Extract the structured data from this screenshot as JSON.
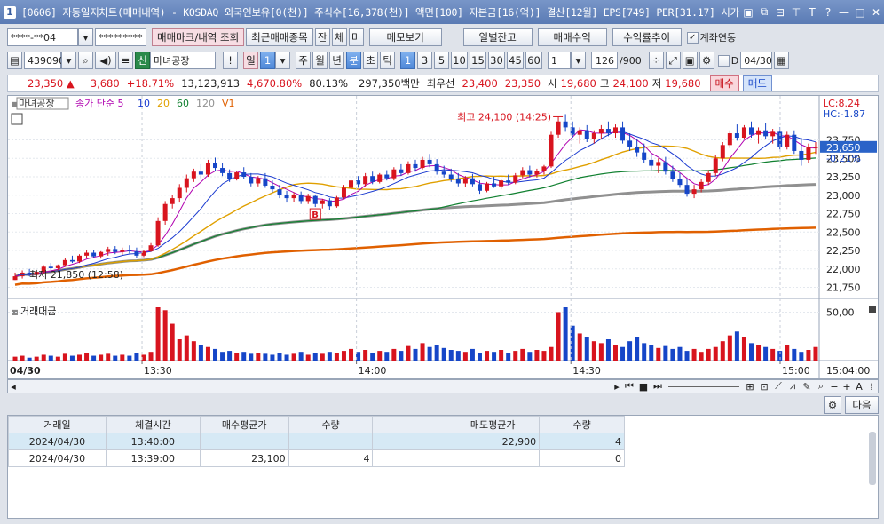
{
  "window": {
    "title": "[0606] 자동일지차트(매매내역) - KOSDAQ 외국인보유[0(천)] 주식수[16,378(천)] 액면[100] 자본금[16(억)] 결산[12월] EPS[749] PER[31.17] 시가"
  },
  "toolbar1": {
    "account": "****-**04",
    "password": "*********",
    "btn_trade_mark": "매매마크/내역 조회",
    "btn_recent": "최근매매종목",
    "btn_jan": "잔",
    "btn_che": "체",
    "btn_mi": "미",
    "btn_memo": "메모보기",
    "btn_daily": "일별잔고",
    "btn_profit": "매매수익",
    "btn_rate": "수익률추이",
    "check_account": "계좌연동"
  },
  "toolbar2": {
    "code": "439090",
    "sin": "신",
    "name": "마녀공장",
    "excl": "!",
    "il": "일",
    "il_num": "1",
    "periods": [
      "주",
      "월",
      "년"
    ],
    "bun": "분",
    "cho": "초",
    "tik": "틱",
    "intervals": [
      "1",
      "3",
      "5",
      "10",
      "15",
      "30",
      "45",
      "60"
    ],
    "count": "1",
    "bars": "126",
    "bars_total": "/900",
    "check_d": "D",
    "date": "04/30"
  },
  "pricebar": {
    "price": "23,350 ▲",
    "change": "3,680",
    "pct": "+18.71%",
    "volume": "13,123,913",
    "vol_pct": "4,670.80%",
    "ratio": "80.13%",
    "amount": "297,350백만",
    "best_label": "최우선",
    "best_ask": "23,400",
    "best_bid": "23,350",
    "open_label": "시",
    "open": "19,680",
    "high_label": "고",
    "high": "24,100",
    "low_label": "저",
    "low": "19,680",
    "buy": "매수",
    "sell": "매도"
  },
  "chart_data": [
    {
      "type": "candlestick",
      "legend": [
        {
          "name": "마녀공장",
          "color": "#333333"
        },
        {
          "name": "종가 단순 5",
          "color": "#b000b0"
        },
        {
          "name": "10",
          "color": "#1a3ad0"
        },
        {
          "name": "20",
          "color": "#e0a000"
        },
        {
          "name": "60",
          "color": "#108030"
        },
        {
          "name": "120",
          "color": "#909090"
        },
        {
          "name": "V1",
          "color": "#e06000"
        }
      ],
      "lc_label": "LC:8.24",
      "hc_label": "HC:-1.87",
      "current": "23,650",
      "current_value": 23650,
      "current_pct": "-0.21%",
      "high_annotation": "최고 24,100 (14:25)",
      "low_annotation": "최저 21,850 (12:58)",
      "trade_marker": "B",
      "y_ticks": [
        "23,750",
        "23,500",
        "23,250",
        "23,000",
        "22,750",
        "22,500",
        "22,250",
        "22,000",
        "21,750"
      ],
      "y_values": [
        23750,
        23500,
        23250,
        23000,
        22750,
        22500,
        22250,
        22000,
        21750
      ],
      "ylim": [
        21600,
        24250
      ],
      "date_label": "04/30",
      "x_ticks": [
        "13:30",
        "14:00",
        "14:30",
        "15:00",
        "15:04:00"
      ],
      "ohlc": [
        [
          21850,
          21950,
          21850,
          21900
        ],
        [
          21900,
          21980,
          21870,
          21950
        ],
        [
          21950,
          22000,
          21900,
          21920
        ],
        [
          21920,
          21980,
          21880,
          21960
        ],
        [
          21960,
          22050,
          21940,
          22030
        ],
        [
          22030,
          22080,
          21990,
          22010
        ],
        [
          22010,
          22060,
          21980,
          22050
        ],
        [
          22050,
          22150,
          22030,
          22120
        ],
        [
          22120,
          22180,
          22080,
          22100
        ],
        [
          22100,
          22200,
          22080,
          22180
        ],
        [
          22180,
          22250,
          22140,
          22220
        ],
        [
          22220,
          22260,
          22150,
          22170
        ],
        [
          22170,
          22240,
          22140,
          22230
        ],
        [
          22230,
          22300,
          22180,
          22270
        ],
        [
          22270,
          22310,
          22200,
          22230
        ],
        [
          22230,
          22290,
          22190,
          22260
        ],
        [
          22260,
          22320,
          22210,
          22240
        ],
        [
          22240,
          22290,
          22150,
          22180
        ],
        [
          22180,
          22260,
          22160,
          22240
        ],
        [
          22240,
          22350,
          22230,
          22320
        ],
        [
          22320,
          22700,
          22300,
          22650
        ],
        [
          22650,
          22920,
          22600,
          22880
        ],
        [
          22880,
          23000,
          22820,
          22960
        ],
        [
          22960,
          23150,
          22900,
          23100
        ],
        [
          23100,
          23280,
          23040,
          23230
        ],
        [
          23230,
          23360,
          23180,
          23320
        ],
        [
          23320,
          23420,
          23220,
          23280
        ],
        [
          23280,
          23480,
          23250,
          23440
        ],
        [
          23440,
          23510,
          23330,
          23370
        ],
        [
          23370,
          23440,
          23260,
          23300
        ],
        [
          23300,
          23350,
          23180,
          23220
        ],
        [
          23220,
          23330,
          23200,
          23310
        ],
        [
          23310,
          23380,
          23220,
          23250
        ],
        [
          23250,
          23300,
          23120,
          23160
        ],
        [
          23160,
          23260,
          23120,
          23230
        ],
        [
          23230,
          23300,
          23100,
          23130
        ],
        [
          23130,
          23200,
          23040,
          23080
        ],
        [
          23080,
          23140,
          22960,
          23000
        ],
        [
          23000,
          23060,
          22900,
          22960
        ],
        [
          22960,
          23040,
          22910,
          23010
        ],
        [
          23010,
          23050,
          22880,
          22920
        ],
        [
          22920,
          23020,
          22880,
          22990
        ],
        [
          22990,
          23010,
          22840,
          22880
        ],
        [
          22880,
          22950,
          22820,
          22930
        ],
        [
          22930,
          22960,
          22800,
          22850
        ],
        [
          22850,
          22990,
          22830,
          22970
        ],
        [
          22970,
          23140,
          22950,
          23100
        ],
        [
          23100,
          23240,
          23060,
          23200
        ],
        [
          23200,
          23260,
          23100,
          23150
        ],
        [
          23150,
          23300,
          23120,
          23260
        ],
        [
          23260,
          23320,
          23150,
          23180
        ],
        [
          23180,
          23300,
          23160,
          23280
        ],
        [
          23280,
          23340,
          23200,
          23230
        ],
        [
          23230,
          23380,
          23200,
          23350
        ],
        [
          23350,
          23420,
          23260,
          23300
        ],
        [
          23300,
          23460,
          23280,
          23420
        ],
        [
          23420,
          23480,
          23320,
          23370
        ],
        [
          23370,
          23520,
          23350,
          23480
        ],
        [
          23480,
          23560,
          23380,
          23420
        ],
        [
          23420,
          23490,
          23280,
          23320
        ],
        [
          23320,
          23400,
          23240,
          23280
        ],
        [
          23280,
          23360,
          23180,
          23220
        ],
        [
          23220,
          23300,
          23120,
          23160
        ],
        [
          23160,
          23260,
          23110,
          23230
        ],
        [
          23230,
          23290,
          23120,
          23150
        ],
        [
          23150,
          23200,
          23020,
          23060
        ],
        [
          23060,
          23180,
          23040,
          23160
        ],
        [
          23160,
          23250,
          23100,
          23120
        ],
        [
          23120,
          23220,
          23080,
          23200
        ],
        [
          23200,
          23280,
          23140,
          23170
        ],
        [
          23170,
          23300,
          23150,
          23270
        ],
        [
          23270,
          23380,
          23230,
          23340
        ],
        [
          23340,
          23400,
          23240,
          23280
        ],
        [
          23280,
          23360,
          23240,
          23330
        ],
        [
          23330,
          23410,
          23280,
          23390
        ],
        [
          23390,
          23860,
          23370,
          23820
        ],
        [
          23820,
          24060,
          23780,
          24000
        ],
        [
          24000,
          24100,
          23860,
          23920
        ],
        [
          23920,
          24000,
          23780,
          23820
        ],
        [
          23820,
          23920,
          23700,
          23880
        ],
        [
          23880,
          23950,
          23720,
          23760
        ],
        [
          23760,
          23880,
          23700,
          23840
        ],
        [
          23840,
          23950,
          23760,
          23900
        ],
        [
          23900,
          24000,
          23800,
          23840
        ],
        [
          23840,
          23960,
          23780,
          23920
        ],
        [
          23920,
          24000,
          23700,
          23740
        ],
        [
          23740,
          23840,
          23600,
          23660
        ],
        [
          23660,
          23760,
          23520,
          23580
        ],
        [
          23580,
          23700,
          23440,
          23480
        ],
        [
          23480,
          23560,
          23340,
          23400
        ],
        [
          23400,
          23500,
          23300,
          23450
        ],
        [
          23450,
          23520,
          23280,
          23320
        ],
        [
          23320,
          23400,
          23180,
          23220
        ],
        [
          23220,
          23300,
          23100,
          23140
        ],
        [
          23140,
          23220,
          22980,
          23020
        ],
        [
          23020,
          23140,
          22960,
          23080
        ],
        [
          23080,
          23220,
          23040,
          23180
        ],
        [
          23180,
          23340,
          23140,
          23300
        ],
        [
          23300,
          23540,
          23260,
          23500
        ],
        [
          23500,
          23720,
          23460,
          23680
        ],
        [
          23680,
          23880,
          23640,
          23840
        ],
        [
          23840,
          23960,
          23740,
          23780
        ],
        [
          23780,
          23950,
          23760,
          23920
        ],
        [
          23920,
          24000,
          23780,
          23820
        ],
        [
          23820,
          23920,
          23700,
          23880
        ],
        [
          23880,
          23980,
          23760,
          23800
        ],
        [
          23800,
          23900,
          23700,
          23860
        ],
        [
          23860,
          23920,
          23620,
          23660
        ],
        [
          23660,
          23860,
          23620,
          23820
        ],
        [
          23820,
          23880,
          23560,
          23600
        ],
        [
          23600,
          23780,
          23400,
          23480
        ],
        [
          23480,
          23700,
          23440,
          23650
        ],
        [
          23650,
          23720,
          23560,
          23650
        ]
      ]
    },
    {
      "type": "bar",
      "title": "거래대금",
      "y_tick": "50,00",
      "y_tick_value": 50,
      "ylim": [
        0,
        55
      ],
      "values": [
        4,
        5,
        3,
        4,
        6,
        5,
        4,
        7,
        5,
        6,
        8,
        5,
        6,
        7,
        5,
        6,
        5,
        8,
        6,
        9,
        55,
        52,
        38,
        22,
        26,
        20,
        16,
        14,
        12,
        9,
        10,
        8,
        9,
        7,
        8,
        7,
        6,
        8,
        6,
        7,
        9,
        6,
        8,
        7,
        9,
        8,
        10,
        12,
        9,
        11,
        8,
        10,
        9,
        12,
        10,
        15,
        12,
        18,
        14,
        16,
        13,
        11,
        10,
        9,
        12,
        8,
        10,
        9,
        11,
        8,
        10,
        12,
        9,
        11,
        10,
        14,
        50,
        55,
        36,
        28,
        24,
        20,
        18,
        22,
        16,
        14,
        20,
        24,
        18,
        16,
        13,
        15,
        12,
        14,
        10,
        12,
        9,
        12,
        14,
        20,
        26,
        30,
        24,
        18,
        16,
        14,
        12,
        10,
        16,
        12,
        9,
        11,
        14,
        8
      ]
    }
  ],
  "scroll_hint": "",
  "grid": {
    "next_button": "다음",
    "columns": [
      "거래일",
      "체결시간",
      "매수평균가",
      "수량",
      "",
      "매도평균가",
      "수량"
    ],
    "rows": [
      [
        "2024/04/30",
        "13:40:00",
        "",
        "",
        "",
        "22,900",
        "4"
      ],
      [
        "2024/04/30",
        "13:39:00",
        "23,100",
        "4",
        "",
        "",
        "0"
      ]
    ]
  },
  "colors": {
    "up": "#d8141e",
    "down": "#1646c8",
    "accent": "#3d6fb8"
  }
}
